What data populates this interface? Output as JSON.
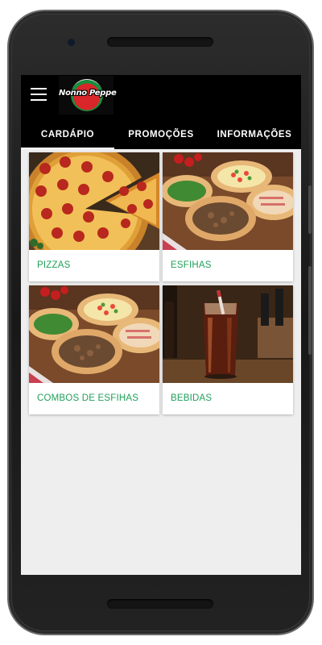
{
  "app": {
    "logo_text": "Nonno Peppe"
  },
  "tabs": [
    {
      "label": "CARDÁPIO",
      "active": true
    },
    {
      "label": "PROMOÇÕES",
      "active": false
    },
    {
      "label": "INFORMAÇÕES",
      "active": false
    }
  ],
  "menu": [
    {
      "label": "PIZZAS",
      "image": "pizza-photo"
    },
    {
      "label": "ESFIHAS",
      "image": "esfihas-photo"
    },
    {
      "label": "COMBOS DE ESFIHAS",
      "image": "combo-esfihas-photo"
    },
    {
      "label": "BEBIDAS",
      "image": "soda-glass-photo"
    }
  ],
  "colors": {
    "accent_text": "#20a05a",
    "app_bar": "#000000",
    "background": "#eeeeee"
  }
}
